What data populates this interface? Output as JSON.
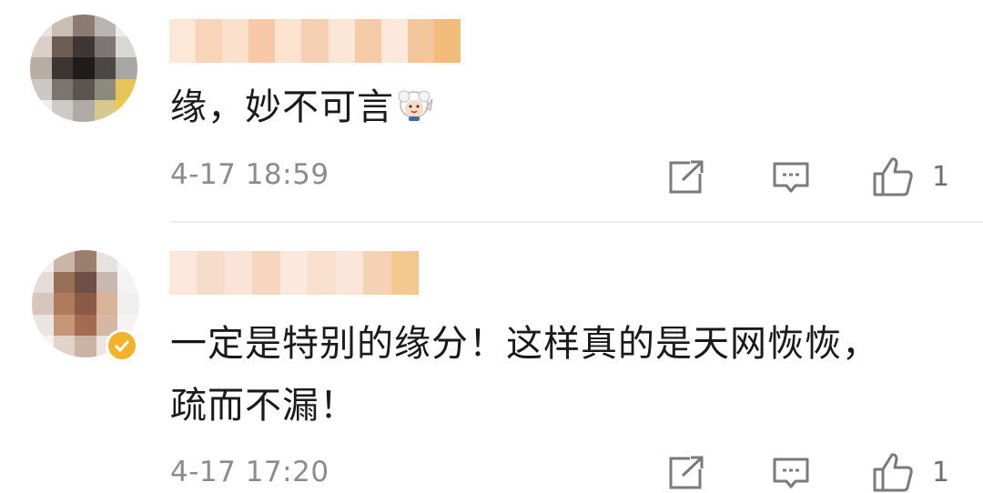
{
  "comments": [
    {
      "text": "缘，妙不可言",
      "time": "4-17 18:59",
      "likes": "1",
      "sticker_icon": "sheep-sticker-icon",
      "verified": false
    },
    {
      "text_line1": "一定是特别的缘分！这样真的是天网恢恢，",
      "text_line2": "疏而不漏！",
      "time": "4-17 17:20",
      "likes": "1",
      "verified": true
    }
  ],
  "icons": {
    "share": "share-icon",
    "reply": "comment-icon",
    "like": "thumbs-up-icon",
    "badge": "verified-badge-icon"
  },
  "colors": {
    "text": "#1a1a1a",
    "meta": "#8c8c8c",
    "icon": "#7a7a7a",
    "divider": "#ececec",
    "badge": "#f2b32a",
    "name_blur": "#f6c9a6"
  }
}
